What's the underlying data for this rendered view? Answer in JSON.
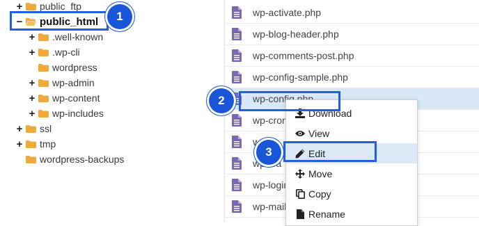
{
  "tree": {
    "items": [
      {
        "label": "public_ftp",
        "toggle": "+"
      },
      {
        "label": "public_html",
        "toggle": "−",
        "bold": true
      },
      {
        "label": ".well-known",
        "toggle": "+"
      },
      {
        "label": ".wp-cli",
        "toggle": "+"
      },
      {
        "label": "wordpress",
        "toggle": ""
      },
      {
        "label": "wp-admin",
        "toggle": "+"
      },
      {
        "label": "wp-content",
        "toggle": "+"
      },
      {
        "label": "wp-includes",
        "toggle": "+"
      },
      {
        "label": "ssl",
        "toggle": "+"
      },
      {
        "label": "tmp",
        "toggle": "+"
      },
      {
        "label": "wordpress-backups",
        "toggle": ""
      }
    ]
  },
  "files": [
    {
      "name": "wp-activate.php"
    },
    {
      "name": "wp-blog-header.php"
    },
    {
      "name": "wp-comments-post.php"
    },
    {
      "name": "wp-config-sample.php"
    },
    {
      "name": "wp-config.php"
    },
    {
      "name": "wp-cron"
    },
    {
      "name": "wp-l"
    },
    {
      "name": "wp-loa"
    },
    {
      "name": "wp-login"
    },
    {
      "name": "wp-mail"
    }
  ],
  "context_menu": {
    "items": [
      {
        "label": "Download",
        "icon": "download-icon"
      },
      {
        "label": "View",
        "icon": "eye-icon"
      },
      {
        "label": "Edit",
        "icon": "pencil-icon"
      },
      {
        "label": "Move",
        "icon": "move-icon"
      },
      {
        "label": "Copy",
        "icon": "copy-icon"
      },
      {
        "label": "Rename",
        "icon": "file-icon"
      }
    ]
  },
  "steps": {
    "one": "1",
    "two": "2",
    "three": "3"
  },
  "colors": {
    "accent": "#1f5fe0",
    "folder": "#f2a93b",
    "file_icon": "#7b68b0",
    "selected_row": "#d9e8f8"
  }
}
